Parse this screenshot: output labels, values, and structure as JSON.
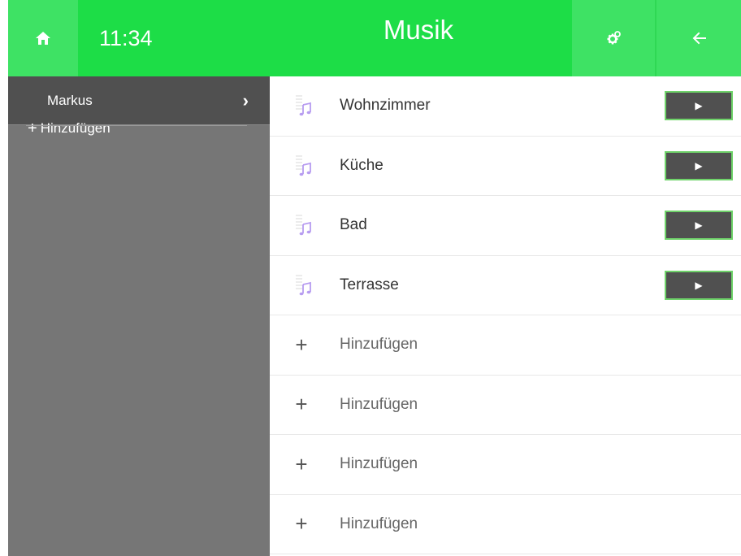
{
  "header": {
    "time": "11:34",
    "title": "Musik",
    "home_icon": "home-icon",
    "settings_icon": "gear-icon",
    "back_icon": "arrow-left-icon"
  },
  "sidebar": {
    "user": {
      "label": "Markus",
      "chevron": "›"
    },
    "add_label": "Hinzufügen",
    "add_symbol": "+"
  },
  "rooms": [
    {
      "label": "Wohnzimmer",
      "play": "▶"
    },
    {
      "label": "Küche",
      "play": "▶"
    },
    {
      "label": "Bad",
      "play": "▶"
    },
    {
      "label": "Terrasse",
      "play": "▶"
    }
  ],
  "add_rows": [
    {
      "symbol": "+",
      "label": "Hinzufügen"
    },
    {
      "symbol": "+",
      "label": "Hinzufügen"
    },
    {
      "symbol": "+",
      "label": "Hinzufügen"
    },
    {
      "symbol": "+",
      "label": "Hinzufügen"
    }
  ],
  "colors": {
    "header_green": "#1ddd47",
    "header_button_green": "#3ee264",
    "sidebar_gray": "#767676",
    "sidebar_selected": "#505050",
    "play_button": "#505050",
    "play_border": "#6fd36a",
    "music_icon": "#b79cf0"
  }
}
